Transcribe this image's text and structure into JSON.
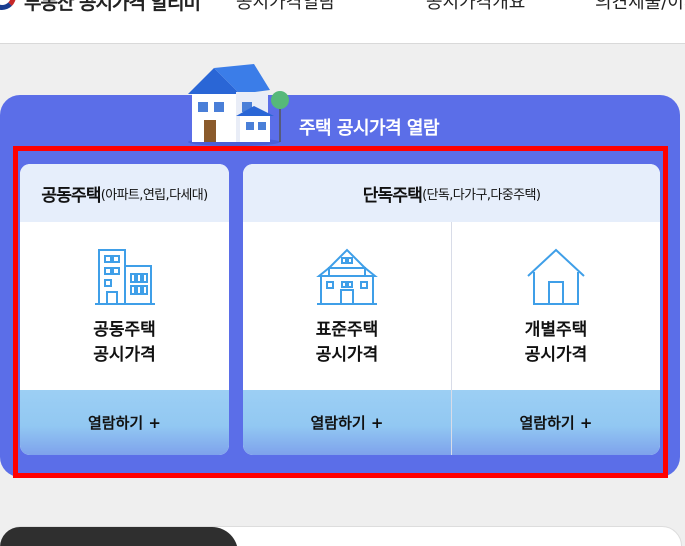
{
  "header": {
    "site_title": "부동산 공시가격 알리미",
    "nav": [
      "공시가격열람",
      "공시가격개요",
      "의견제출/이의신청"
    ]
  },
  "panel": {
    "title": "주택 공시가격 열람"
  },
  "cards": {
    "apartment": {
      "head_strong": "공동주택",
      "head_sub": "(아파트,연립,다세대)",
      "item_line1": "공동주택",
      "item_line2": "공시가격",
      "button": "열람하기 +",
      "icon": "apartment-building-icon"
    },
    "detached": {
      "head_strong": "단독주택",
      "head_sub": "(단독,다가구,다중주택)",
      "standard": {
        "line1": "표준주택",
        "line2": "공시가격",
        "button": "열람하기 +",
        "icon": "standard-house-icon"
      },
      "individual": {
        "line1": "개별주택",
        "line2": "공시가격",
        "button": "열람하기 +",
        "icon": "house-outline-icon"
      }
    }
  },
  "colors": {
    "panel_blue": "#5b6ee8",
    "card_head": "#e6eefb",
    "button_blue": "#92c8f2",
    "highlight_red": "#ff0000",
    "icon_blue": "#3f9fe8"
  }
}
